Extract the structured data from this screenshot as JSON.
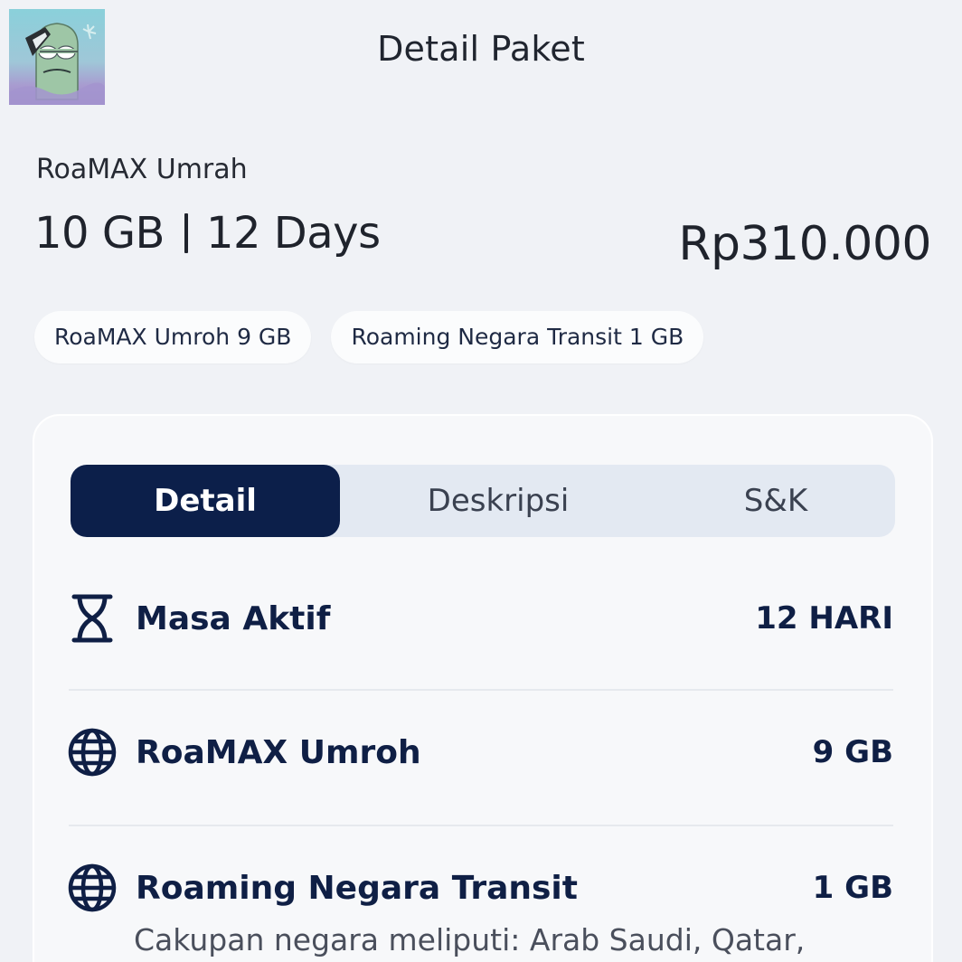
{
  "header": {
    "title": "Detail Paket"
  },
  "package": {
    "name": "RoaMAX Umrah",
    "quota": "10 GB",
    "duration": "12 Days",
    "price": "Rp310.000"
  },
  "chips": [
    {
      "label": "RoaMAX Umroh 9 GB"
    },
    {
      "label": "Roaming Negara Transit 1 GB"
    }
  ],
  "tabs": [
    {
      "label": "Detail",
      "active": true
    },
    {
      "label": "Deskripsi",
      "active": false
    },
    {
      "label": "S&K",
      "active": false
    }
  ],
  "details": [
    {
      "icon": "hourglass-icon",
      "label": "Masa Aktif",
      "value": "12 HARI"
    },
    {
      "icon": "globe-icon",
      "label": "RoaMAX Umroh",
      "value": "9 GB"
    },
    {
      "icon": "globe-icon",
      "label": "Roaming Negara Transit",
      "value": "1 GB",
      "description": "Cakupan negara meliputi: Arab Saudi, Qatar,"
    }
  ],
  "colors": {
    "background": "#f0f2f6",
    "accent": "#0c1f4a",
    "tab_bar": "#e3e9f2",
    "card": "#f7f8fa"
  }
}
